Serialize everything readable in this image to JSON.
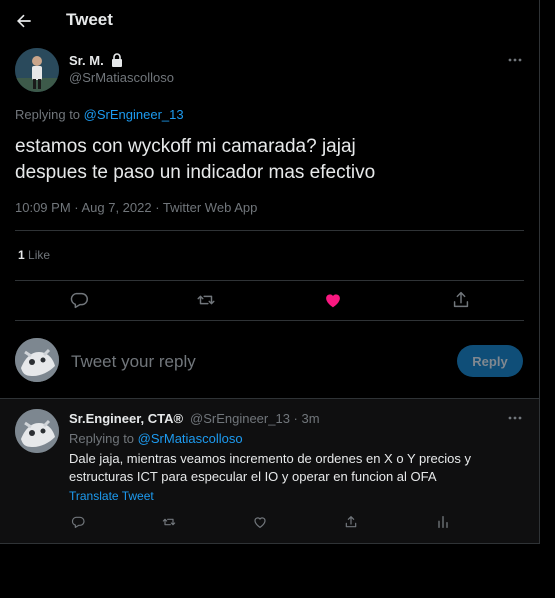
{
  "header": {
    "title": "Tweet"
  },
  "tweet": {
    "author_name": "Sr. M.",
    "author_handle": "@SrMatiascolloso",
    "replying_prefix": "Replying to",
    "replying_to": "@SrEngineer_13",
    "text_line1": "estamos con wyckoff mi camarada? jajaj",
    "text_line2": "despues te paso un indicador mas efectivo",
    "meta": "10:09 PM · Aug 7, 2022 · Twitter Web App",
    "like_count": "1",
    "like_label": "Like"
  },
  "reply_box": {
    "placeholder": "Tweet your reply",
    "button_label": "Reply"
  },
  "reply_tweet": {
    "author_name": "Sr.Engineer, CTA®",
    "author_handle": "@SrEngineer_13 · 3m",
    "replying_prefix": "Replying to",
    "replying_to": "@SrMatiascolloso",
    "text_line1": "Dale jaja, mientras veamos incremento de ordenes en X o Y precios y",
    "text_line2": "estructuras ICT para especular el IO y operar en funcion al OFA",
    "translate": "Translate Tweet"
  },
  "colors": {
    "accent": "#1d9bf0",
    "like_active": "#f91880",
    "background": "#000000",
    "muted": "#71767b",
    "border": "#2f3336"
  }
}
